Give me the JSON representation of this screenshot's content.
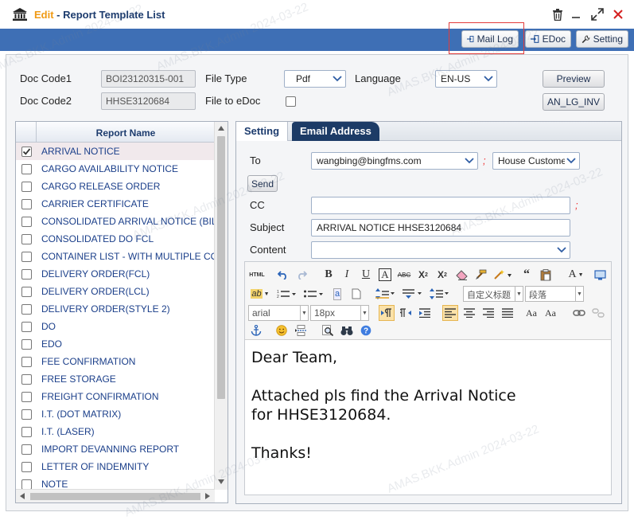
{
  "window": {
    "title_prefix": "Edit",
    "title_sep": " - ",
    "title": "Report Template List"
  },
  "toolbar": {
    "mail_log": "Mail Log",
    "edoc": "EDoc",
    "setting": "Setting"
  },
  "form": {
    "doc_code1_label": "Doc Code1",
    "doc_code1_value": "BOI23120315-001",
    "doc_code2_label": "Doc Code2",
    "doc_code2_value": "HHSE3120684",
    "file_type_label": "File Type",
    "file_type_value": "Pdf",
    "file_to_edoc_label": "File to eDoc",
    "language_label": "Language",
    "language_value": "EN-US",
    "preview_button": "Preview",
    "an_lg_inv_button": "AN_LG_INV"
  },
  "report_list": {
    "header": "Report Name",
    "items": [
      {
        "label": "ARRIVAL NOTICE",
        "checked": true
      },
      {
        "label": "CARGO AVAILABILITY NOTICE",
        "checked": false
      },
      {
        "label": "CARGO RELEASE ORDER",
        "checked": false
      },
      {
        "label": "CARRIER CERTIFICATE",
        "checked": false
      },
      {
        "label": "CONSOLIDATED ARRIVAL NOTICE (BIL",
        "checked": false
      },
      {
        "label": "CONSOLIDATED DO FCL",
        "checked": false
      },
      {
        "label": "CONTAINER LIST - WITH MULTIPLE CO",
        "checked": false
      },
      {
        "label": "DELIVERY ORDER(FCL)",
        "checked": false
      },
      {
        "label": "DELIVERY ORDER(LCL)",
        "checked": false
      },
      {
        "label": "DELIVERY ORDER(STYLE 2)",
        "checked": false
      },
      {
        "label": "DO",
        "checked": false
      },
      {
        "label": "EDO",
        "checked": false
      },
      {
        "label": "FEE CONFIRMATION",
        "checked": false
      },
      {
        "label": "FREE STORAGE",
        "checked": false
      },
      {
        "label": "FREIGHT CONFIRMATION",
        "checked": false
      },
      {
        "label": "I.T. (DOT MATRIX)",
        "checked": false
      },
      {
        "label": "I.T. (LASER)",
        "checked": false
      },
      {
        "label": "IMPORT DEVANNING REPORT",
        "checked": false
      },
      {
        "label": "LETTER OF INDEMNITY",
        "checked": false
      },
      {
        "label": "NOTE",
        "checked": false
      }
    ]
  },
  "tabs": {
    "setting": "Setting",
    "email_address": "Email Address"
  },
  "email": {
    "to_label": "To",
    "to_value": "wangbing@bingfms.com",
    "to_type_value": "House Customer",
    "send_button": "Send",
    "cc_label": "CC",
    "cc_value": "",
    "subject_label": "Subject",
    "subject_value": "ARRIVAL NOTICE HHSE3120684",
    "content_label": "Content",
    "content_value": "",
    "separator": ";"
  },
  "editor": {
    "html_label": "HTML",
    "font_family": "arial",
    "font_size": "18px",
    "custom_heading": "自定义标题",
    "paragraph": "段落",
    "body_lines": [
      "Dear Team,",
      "",
      "Attached pls find the Arrival Notice",
      "for HHSE3120684.",
      "",
      "Thanks!"
    ]
  },
  "watermark": "AMAS.BKK.Admin 2024-03-22"
}
